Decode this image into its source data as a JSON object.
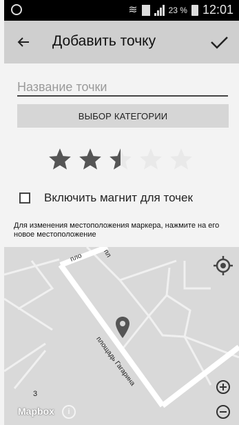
{
  "status_bar": {
    "battery_percent": "23 %",
    "time": "12:01",
    "sim_label": "1"
  },
  "app_bar": {
    "title": "Добавить точку"
  },
  "form": {
    "name_placeholder": "Название точки",
    "category_button": "ВЫБОР КАТЕГОРИИ",
    "rating": {
      "value": 2.5,
      "max": 5
    },
    "magnet_checkbox": {
      "label": "Включить магнит для точек",
      "checked": false
    },
    "hint": "Для изменения местоположения маркера, нажмите на его новое местоположение"
  },
  "map": {
    "street_label_1": "площадь Гагарина",
    "street_label_2": "пло",
    "street_label_3": "пл",
    "number_label": "3",
    "attribution": "Mapbox",
    "info_icon_label": "i"
  },
  "colors": {
    "app_bar_bg": "#cfcfcf",
    "star_filled": "#555555",
    "star_empty": "#e9e9e9",
    "map_bg": "#d9d9d9"
  }
}
